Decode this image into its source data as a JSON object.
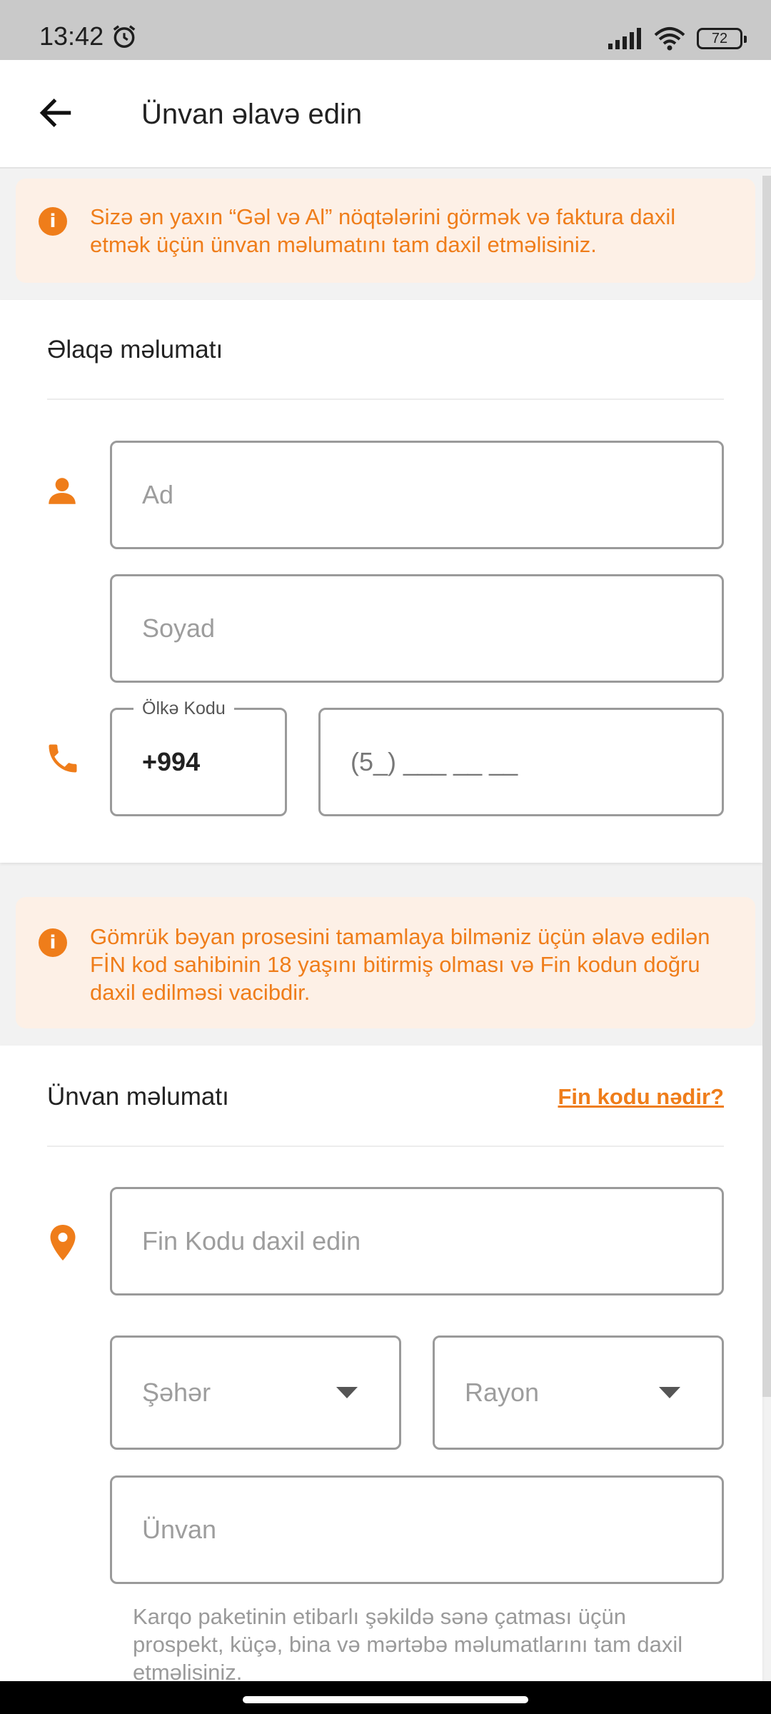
{
  "status_bar": {
    "time": "13:42",
    "battery": "72"
  },
  "header": {
    "title": "Ünvan əlavə edin"
  },
  "info_top": {
    "text": "Sizə ən yaxın “Gəl və Al” nöqtələrini görmək və faktura daxil etmək üçün ünvan məlumatını tam daxil etməlisiniz."
  },
  "contact": {
    "title": "Əlaqə məlumatı",
    "first_name_placeholder": "Ad",
    "last_name_placeholder": "Soyad",
    "country_code_label": "Ölkə Kodu",
    "country_code_value": "+994",
    "phone_placeholder": "(5_) ___ __ __"
  },
  "info_fin": {
    "text": "Gömrük bəyan prosesini tamamlaya bilməniz üçün əlavə edilən FİN kod sahibinin 18 yaşını bitirmiş olması və Fin kodun doğru daxil edilməsi vacibdir."
  },
  "address": {
    "title": "Ünvan məlumatı",
    "fin_link": "Fin kodu nədir?",
    "fin_placeholder": "Fin Kodu daxil edin",
    "city_placeholder": "Şəhər",
    "district_placeholder": "Rayon",
    "address_placeholder": "Ünvan",
    "helper_text": "Karqo paketinin etibarlı şəkildə sənə çatması üçün prospekt, küçə, bina və mərtəbə məlumatlarını tam daxil etməlisiniz."
  },
  "colors": {
    "accent": "#ef7d1a",
    "info_bg": "#fdf0e6"
  },
  "icons": {
    "back": "arrow-left-icon",
    "info": "info-icon",
    "person": "person-icon",
    "phone": "phone-icon",
    "location": "location-pin-icon",
    "dropdown": "caret-down-icon"
  }
}
